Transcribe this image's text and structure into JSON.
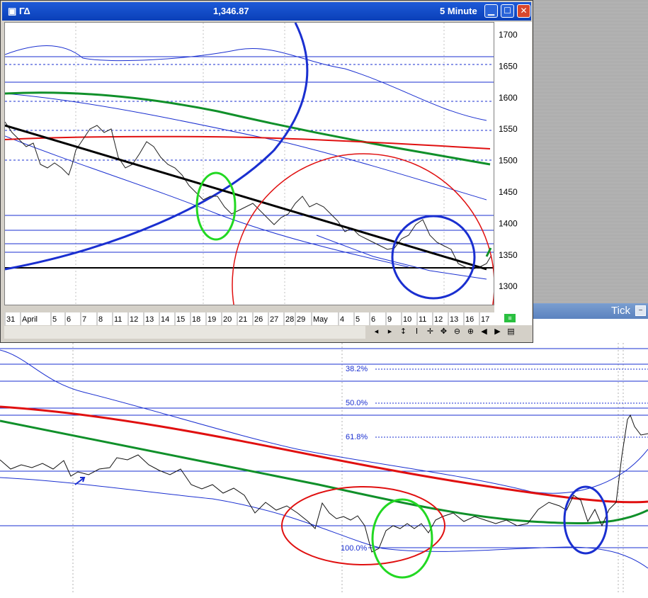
{
  "window": {
    "symbol": "ΓΔ",
    "last_price": "1,346.87",
    "interval": "5 Minute",
    "minimize_icon": "minimize-icon",
    "maximize_icon": "maximize-icon",
    "close_icon": "close-icon"
  },
  "y_axis": {
    "labels": [
      "1700",
      "1650",
      "1600",
      "1550",
      "1500",
      "1450",
      "1400",
      "1350",
      "1300"
    ]
  },
  "x_axis": {
    "labels": [
      "31",
      "April",
      "5",
      "6",
      "7",
      "8",
      "11",
      "12",
      "13",
      "14",
      "15",
      "18",
      "19",
      "20",
      "21",
      "26",
      "27",
      "28",
      "29",
      "May",
      "4",
      "5",
      "6",
      "9",
      "10",
      "11",
      "12",
      "13",
      "16",
      "17"
    ]
  },
  "navigation": {
    "icons": [
      "scroll-left-icon",
      "scroll-right-icon",
      "zoom-vertical-icon",
      "cursor-icon",
      "move-icon",
      "pan-icon",
      "zoom-out-icon",
      "zoom-in-icon",
      "prev-icon",
      "next-icon",
      "list-icon"
    ]
  },
  "right_panel": {
    "tick_label": "Tick"
  },
  "fib_levels": [
    "38.2%",
    "50.0%",
    "61.8%",
    "100.0%"
  ],
  "colors": {
    "titlebar": "#0a3fb8",
    "price_line": "#000000",
    "red_average": "#e01010",
    "green_average": "#10902a",
    "blue_band": "#1a2fd0",
    "fib_line": "#1a2fd0"
  }
}
